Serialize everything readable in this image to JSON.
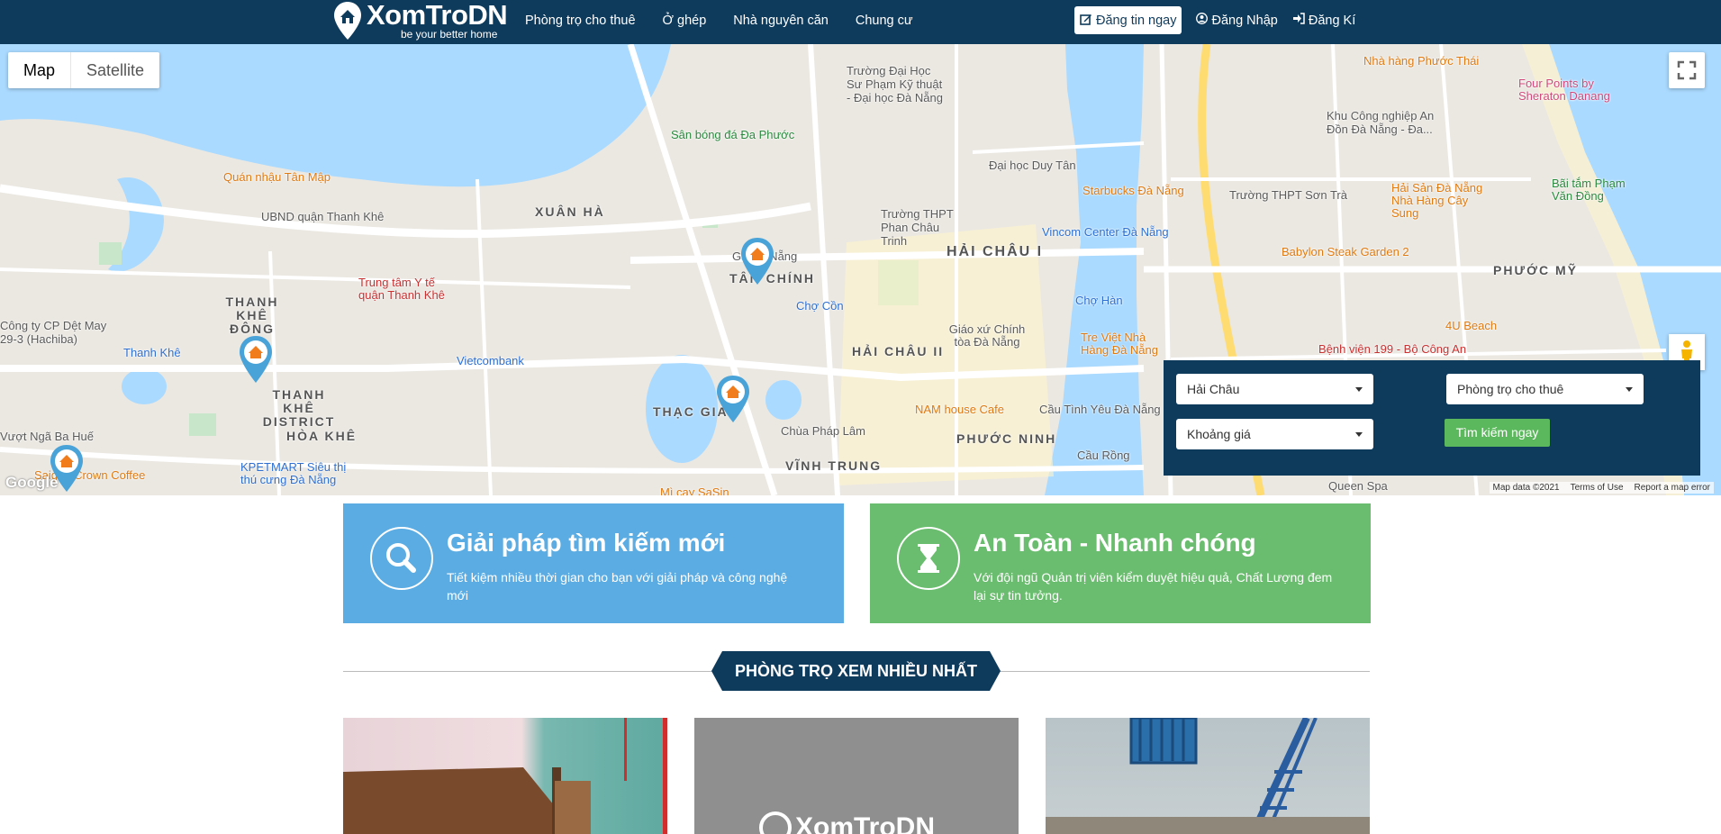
{
  "brand": {
    "name": "XomTroDN",
    "tagline": "be your better home"
  },
  "nav": {
    "links": [
      "Phòng trọ cho thuê",
      "Ở ghép",
      "Nhà nguyên căn",
      "Chung cư"
    ],
    "post_label": "Đăng tin ngay",
    "login_label": "Đăng Nhập",
    "register_label": "Đăng Kí"
  },
  "map": {
    "type_map": "Map",
    "type_satellite": "Satellite",
    "attribution": {
      "data": "Map data ©2021",
      "terms": "Terms of Use",
      "report": "Report a map error"
    },
    "google": "Google",
    "labels": {
      "xuan_ha": "XUÂN HÀ",
      "hai_chau_i": "HẢI CHÂU I",
      "hai_chau_ii": "HẢI CHÂU II",
      "thanh_khe_dong": "THANH KHÊ ĐÔNG",
      "thanh_khe_district": "THANH KHÊ DISTRICT",
      "hoa_khe": "HÒA KHÊ",
      "thac_gian": "THẠC GIA",
      "vinh_trung": "VĨNH TRUNG",
      "phuoc_ninh": "PHƯỚC NINH",
      "phuoc_my": "PHƯỚC MỸ",
      "tan_chinh": "TÂN CHÍNH",
      "quan_nhau": "Quán nhậu Tân Mập",
      "san_bong": "Sân bóng đá Đa Phước",
      "truong_su_pham": "Trường Đại Học Sư Phạm Kỹ thuật - Đại học Đà Nẵng",
      "ubnd": "UBND quận Thanh Khê",
      "trung_tam_yte": "Trung tâm Y tế quận Thanh Khê",
      "cong_ty": "Công ty CP Dệt May 29-3 (Hachiba)",
      "vietcombank": "Vietcombank",
      "kpetmart": "KPETMART Siêu thị thú cưng Đà Nẵng",
      "dai_hoc_duy_tan": "Đại học Duy Tân",
      "truong_thpt_pct": "Trường THPT Phan Châu Trinh",
      "ga_da_nang": "Ga Đà Nẵng",
      "cho_con": "Chợ Cồn",
      "cho_han": "Chợ Hàn",
      "starbucks": "Starbucks Đà Nẵng",
      "vincom": "Vincom Center Đà Nẵng",
      "giao_xu": "Giáo xứ Chính tòa Đà Nẵng",
      "tre_viet": "Tre Việt Nhà Hàng Đà Nẵng",
      "nam_house": "NAM house Cafe",
      "cau_tinh_yeu": "Cầu Tình Yêu Đà Nẵng",
      "chua_phap_lam": "Chùa Pháp Lâm",
      "cau_rong": "Cầu Rồng",
      "queen_spa": "Queen Spa",
      "nha_hang_phuoc_thai": "Nhà hàng Phước Thái",
      "four_points": "Four Points by Sheraton Danang",
      "khu_cong_nghiep": "Khu Công nghiệp An Đồn Đà Nẵng - Đa...",
      "truong_thpt_son_tra": "Trường THPT Sơn Trà",
      "hai_san": "Hải Sản Đà Nẵng Nhà Hàng Cây Sung",
      "bai_tam": "Bãi tắm Phạm Văn Đồng",
      "babylon": "Babylon Steak Garden 2",
      "four_u": "4U Beach",
      "benh_vien": "Bệnh viện 199 - Bộ Công An",
      "thanh_khe": "Thanh Khê",
      "vuot_nga": "Vượt Ngã Ba Huế",
      "saigon": "Saigon Crown Coffee",
      "mi_cay": "Mì cay SaSin"
    }
  },
  "search": {
    "district": "Hải Châu",
    "type": "Phòng trọ cho thuê",
    "price": "Khoảng giá",
    "button": "Tìm kiếm ngay"
  },
  "features": [
    {
      "title": "Giải pháp tìm kiếm mới",
      "desc": "Tiết kiệm nhiều thời gian cho bạn với giải pháp và công nghệ mới"
    },
    {
      "title": "An Toàn - Nhanh chóng",
      "desc": "Với đội ngũ Quản trị viên kiểm duyệt hiệu quả, Chất Lượng đem lại sự tin tưởng."
    }
  ],
  "section": {
    "title": "PHÒNG TRỌ XEM NHIỀU NHẤT"
  },
  "cards": {
    "placeholder_brand": "XomTroDN"
  },
  "colors": {
    "nav_bg": "#0e3a5c",
    "search_btn": "#5cb85c",
    "feature_blue": "#5aace3",
    "feature_green": "#6abd6e",
    "pin": "#4aa3d8",
    "pin_home": "#f07c1c"
  }
}
